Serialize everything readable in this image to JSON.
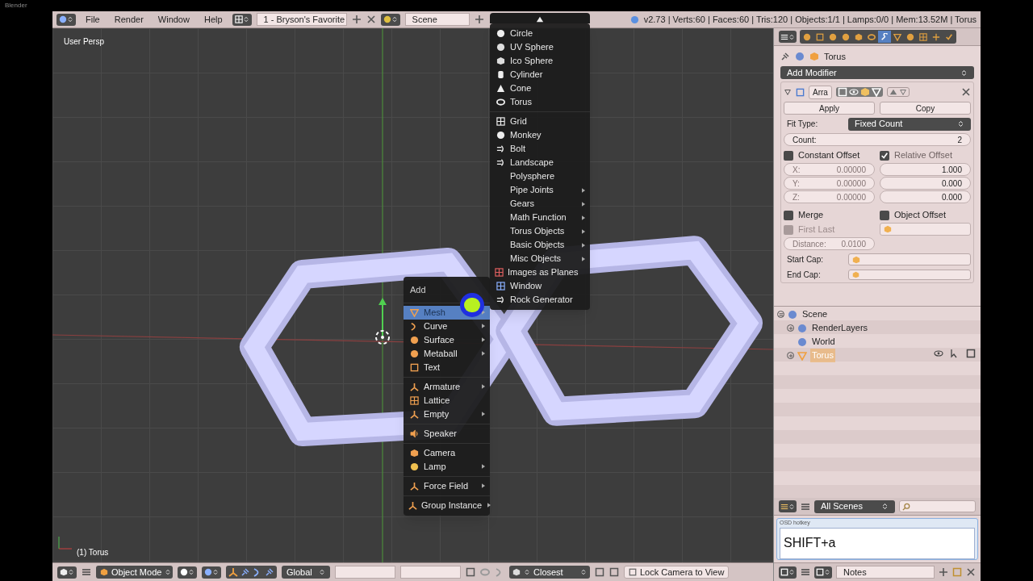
{
  "window": {
    "title": "Blender"
  },
  "top_header": {
    "menus": [
      "File",
      "Render",
      "Window",
      "Help"
    ],
    "screen_layout": "1 - Bryson's Favorite",
    "scene": "Scene",
    "info": "v2.73 | Verts:60 | Faces:60 | Tris:120 | Objects:1/1 | Lamps:0/0 | Mem:13.52M | Torus"
  },
  "viewport": {
    "view_label": "User Persp",
    "object_label": "(1) Torus"
  },
  "add_menu": {
    "title": "Add",
    "groups": [
      [
        {
          "label": "Mesh",
          "submenu": true,
          "selected": true
        },
        {
          "label": "Curve",
          "submenu": true,
          "selected": false
        },
        {
          "label": "Surface",
          "submenu": true,
          "selected": false
        },
        {
          "label": "Metaball",
          "submenu": true,
          "selected": false
        },
        {
          "label": "Text",
          "submenu": false,
          "selected": false
        }
      ],
      [
        {
          "label": "Armature",
          "submenu": true,
          "selected": false
        },
        {
          "label": "Lattice",
          "submenu": false,
          "selected": false
        },
        {
          "label": "Empty",
          "submenu": true,
          "selected": false
        }
      ],
      [
        {
          "label": "Speaker",
          "submenu": false,
          "selected": false
        }
      ],
      [
        {
          "label": "Camera",
          "submenu": false,
          "selected": false
        },
        {
          "label": "Lamp",
          "submenu": true,
          "selected": false
        }
      ],
      [
        {
          "label": "Force Field",
          "submenu": true,
          "selected": false
        }
      ],
      [
        {
          "label": "Group Instance",
          "submenu": true,
          "selected": false
        }
      ]
    ]
  },
  "mesh_menu": {
    "groups": [
      [
        {
          "label": "Circle",
          "submenu": false
        },
        {
          "label": "UV Sphere",
          "submenu": false
        },
        {
          "label": "Ico Sphere",
          "submenu": false
        },
        {
          "label": "Cylinder",
          "submenu": false
        },
        {
          "label": "Cone",
          "submenu": false
        },
        {
          "label": "Torus",
          "submenu": false
        }
      ],
      [
        {
          "label": "Grid",
          "submenu": false
        },
        {
          "label": "Monkey",
          "submenu": false
        },
        {
          "label": "Bolt",
          "submenu": false
        },
        {
          "label": "Landscape",
          "submenu": false
        },
        {
          "label": "Polysphere",
          "submenu": false
        },
        {
          "label": "Pipe Joints",
          "submenu": true
        },
        {
          "label": "Gears",
          "submenu": true
        },
        {
          "label": "Math Function",
          "submenu": true
        },
        {
          "label": "Torus Objects",
          "submenu": true
        },
        {
          "label": "Basic Objects",
          "submenu": true
        },
        {
          "label": "Misc Objects",
          "submenu": true
        },
        {
          "label": "Images as Planes",
          "submenu": false
        },
        {
          "label": "Window",
          "submenu": false
        },
        {
          "label": "Rock Generator",
          "submenu": false
        }
      ]
    ]
  },
  "properties": {
    "tabs": [
      {
        "selected": false
      },
      {
        "selected": false
      },
      {
        "selected": false
      },
      {
        "selected": false
      },
      {
        "selected": false
      },
      {
        "selected": false
      },
      {
        "selected": true
      },
      {
        "selected": false
      },
      {
        "selected": false
      },
      {
        "selected": false
      },
      {
        "selected": false
      },
      {
        "selected": false
      }
    ],
    "object_name": "Torus",
    "add_modifier": "Add Modifier",
    "modifier": {
      "name": "Arra",
      "apply": "Apply",
      "copy": "Copy",
      "fit_type_label": "Fit Type:",
      "fit_type": "Fixed Count",
      "count_label": "Count:",
      "count": "2",
      "constant_offset": {
        "label": "Constant Offset",
        "checked": false,
        "fields": [
          {
            "label": "X:",
            "value": "0.00000"
          },
          {
            "label": "Y:",
            "value": "0.00000"
          },
          {
            "label": "Z:",
            "value": "0.00000"
          }
        ]
      },
      "relative_offset": {
        "label": "Relative Offset",
        "checked": true,
        "fields": [
          {
            "value": "1.000"
          },
          {
            "value": "0.000"
          },
          {
            "value": "0.000"
          }
        ]
      },
      "merge": {
        "label": "Merge",
        "checked": false
      },
      "object_offset": {
        "label": "Object Offset",
        "checked": false
      },
      "first_last": {
        "label": "First Last",
        "checked": false,
        "disabled": true
      },
      "distance_label": "Distance:",
      "distance": "0.0100",
      "start_cap": "Start Cap:",
      "end_cap": "End Cap:"
    }
  },
  "outliner": {
    "tree": [
      {
        "label": "Scene",
        "expanded": true,
        "selected": false,
        "children": [
          {
            "label": "RenderLayers",
            "expanded": false,
            "selected": false
          },
          {
            "label": "World",
            "selected": false
          },
          {
            "label": "Torus",
            "expanded": false,
            "selected": true
          }
        ]
      }
    ],
    "filter": "All Scenes"
  },
  "osd": {
    "title": "OSD hotkey",
    "text": "SHIFT+a"
  },
  "bottom_header": {
    "mode": "Object Mode",
    "orientation": "Global",
    "snap": "Closest",
    "lock_camera": "Lock Camera to View"
  },
  "notes_header": {
    "text": "Notes"
  }
}
